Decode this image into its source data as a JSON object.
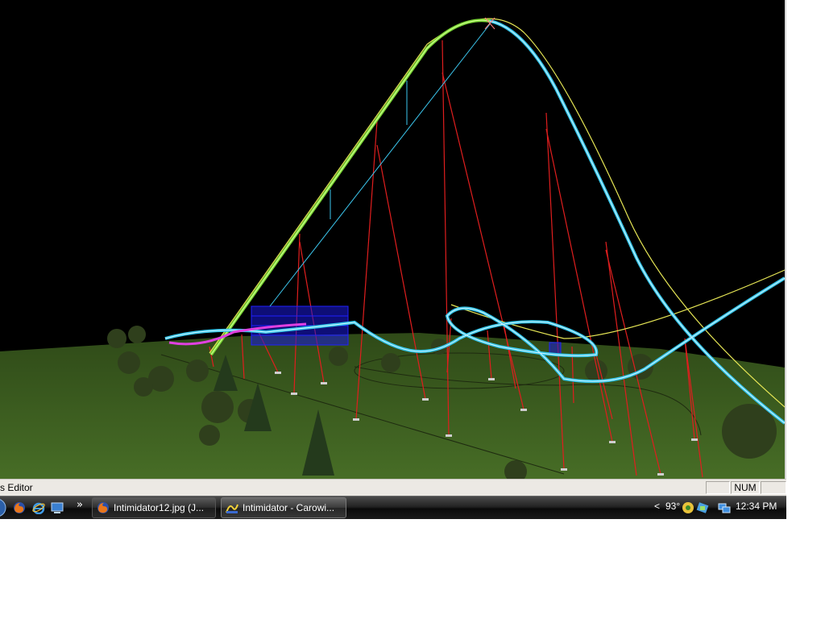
{
  "statusbar": {
    "text": "s Editor",
    "panes": [
      "",
      "NUM",
      ""
    ]
  },
  "taskbar": {
    "quicklaunch": [
      "firefox-icon",
      "ie-icon",
      "show-desktop-icon"
    ],
    "more": "»",
    "tasks": [
      {
        "label": "Intimidator12.jpg (J...",
        "icon": "firefox-icon"
      },
      {
        "label": "Intimidator - Carowi...",
        "icon": "coaster-editor-icon"
      }
    ],
    "tray": {
      "arrow": "<",
      "temperature": "93°",
      "clock": "12:34 PM"
    }
  },
  "colors": {
    "ground": "#3b5a1e",
    "track": "#35c6ea",
    "lift_hill": "#7ad835",
    "supports": "#e01e1e",
    "station": "#1a1ae0",
    "taskbar": "#1a1a1a"
  }
}
